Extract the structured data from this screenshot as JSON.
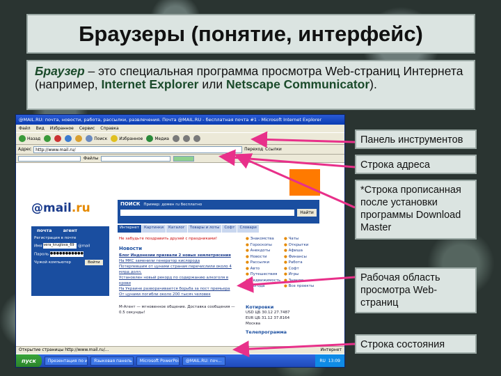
{
  "slide": {
    "title": "Браузеры (понятие, интерфейс)",
    "definition": {
      "term": "Браузер",
      "text_1": " – это специальная программа просмотра Web-страниц Интернета (например, ",
      "ie": "Internet Explorer",
      "text_2": " или ",
      "netscape": "Netscape Communicator",
      "text_3": ")."
    }
  },
  "callouts": [
    {
      "label": "Панель инструментов"
    },
    {
      "label": "Строка адреса"
    },
    {
      "label": "*Строка прописанная после установки программы Download Master"
    },
    {
      "label": "Рабочая область просмотра Web-страниц"
    },
    {
      "label": "Строка состояния"
    }
  ],
  "browser": {
    "window_title": "@MAIL.RU: почта, новости, работа, рассылки, развлечения. Почта @MAIL.RU - бесплатная почта #1 - Microsoft Internet Explorer",
    "menu": [
      "Файл",
      "Вид",
      "Избранное",
      "Сервис",
      "Справка"
    ],
    "toolbar": {
      "back": "Назад",
      "search": "Поиск",
      "favorites": "Избранное",
      "media": "Медиа"
    },
    "address": {
      "label": "Адрес",
      "value": "http://www.mail.ru/",
      "go": "Переход",
      "links": "Ссылки"
    },
    "download_master": {
      "label": "Файлы"
    },
    "page": {
      "logo_main": "@mail",
      "logo_suffix": ".ru",
      "mail_tab": "почта",
      "agent_tab": "агент",
      "register": "Регистрация в почте",
      "name_label": "Имя",
      "name_value": "vera_kruglova_69",
      "domain": "@mail",
      "password_label": "Пароль",
      "password_value": "●●●●●●●●●●●",
      "remember": "Чужой компьютер",
      "login_button": "Войти",
      "search_label": "ПОИСК",
      "search_hint": "Пример: домен ru бесплатно",
      "search_button": "Найти",
      "search_tabs": [
        "Интернет",
        "Картинки",
        "Каталог",
        "Товары и лоты",
        "Софт",
        "Словари"
      ],
      "promo": "Не забудьте поздравить друзей с праздниками!",
      "news_title": "Новости",
      "news_lead": "Блог Индонезии призвали 2 новых землетрясения",
      "news_items": [
        "На МКС заменили генератор кислорода",
        "Потерпевшим от цунами странам перечислили около 4 млрд долл.",
        "Установлен новый рекорд по содержанию алкоголя в крови",
        "На Украине разворачивается борьба за пост премьера",
        "От цунами погибли около 200 тысяч человек"
      ],
      "agent_line": "М-Агент — мгновенное общение. Доставка сообщения — 0.5 секунды!",
      "categories": [
        "Знакомства",
        "Чаты",
        "Гороскопы",
        "Открытки",
        "Анекдоты",
        "Афиша",
        "Новости",
        "Финансы",
        "Рассылки",
        "Работа",
        "Авто",
        "Софт",
        "Путешествия",
        "Игры",
        "Недвижимость",
        "Знаком",
        "Погода",
        "Все проекты"
      ],
      "course_title": "Котировки",
      "course_lines": [
        "USD ЦБ 30.12 27.7487",
        "EUR ЦБ 31.12 37.8164"
      ],
      "city": "Москва",
      "tv_title": "Телепрограмма"
    },
    "status": {
      "left": "Открытие страницы http://www.mail.ru/...",
      "right": "Интернет"
    },
    "taskbar": {
      "start": "пуск",
      "items": [
        "Презентация по ин...",
        "Языковая панель",
        "Microsoft PowerPoi...",
        "@MAIL.RU: поч..."
      ],
      "lang": "RU",
      "time": "13:09"
    }
  },
  "colors": {
    "callout_bg": "#dbe4e1",
    "arrow": "#e8308a",
    "title_text": "#111111"
  }
}
